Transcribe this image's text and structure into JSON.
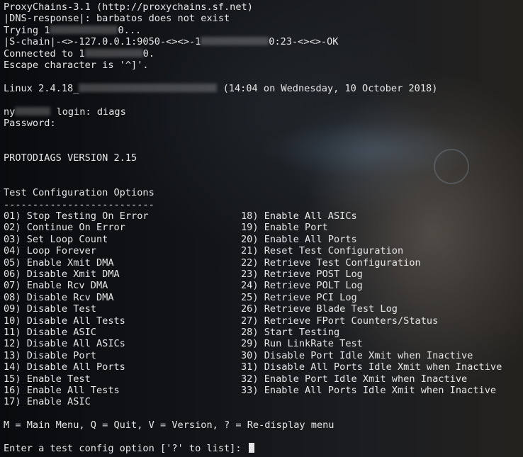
{
  "header": {
    "proxy_banner": "ProxyChains-3.1 (http://proxychains.sf.net)",
    "dns_response": "|DNS-response|: barbatos does not exist",
    "trying_prefix": "Trying 1",
    "trying_suffix": "0...",
    "schain_prefix": "|S-chain|-<>-127.0.0.1:9050-<><>-1",
    "schain_suffix": "0:23-<><>-OK",
    "connected_prefix": "Connected to 1",
    "connected_suffix": "0.",
    "escape": "Escape character is '^]'."
  },
  "login": {
    "linux_prefix": "Linux 2.4.18_",
    "linux_suffix": "(14:04 on Wednesday, 10 October 2018)",
    "host_prefix": "ny",
    "login_suffix": " login: diags",
    "password": "Password:"
  },
  "banner": {
    "version": "PROTODIAGS VERSION 2.15"
  },
  "menu": {
    "title": "Test Configuration Options",
    "underline": "--------------------------",
    "left": [
      "01) Stop Testing On Error",
      "02) Continue On Error",
      "03) Set Loop Count",
      "04) Loop Forever",
      "05) Enable Xmit DMA",
      "06) Disable Xmit DMA",
      "07) Enable Rcv DMA",
      "08) Disable Rcv DMA",
      "09) Disable Test",
      "10) Disable All Tests",
      "11) Disable ASIC",
      "12) Disable All ASICs",
      "13) Disable Port",
      "14) Disable All Ports",
      "15) Enable Test",
      "16) Enable All Tests",
      "17) Enable ASIC"
    ],
    "right": [
      "18) Enable All ASICs",
      "19) Enable Port",
      "20) Enable All Ports",
      "21) Reset Test Configuration",
      "22) Retrieve Test Configuration",
      "23) Retrieve POST Log",
      "24) Retrieve POLT Log",
      "25) Retrieve PCI Log",
      "26) Retrieve Blade Test Log",
      "27) Retrieve FPort Counters/Status",
      "28) Start Testing",
      "29) Run LinkRate Test",
      "30) Disable Port Idle Xmit when Inactive",
      "31) Disable All Ports Idle Xmit when Inactive",
      "32) Enable Port Idle Xmit when Inactive",
      "33) Enable All Ports Idle Xmit when Inactive"
    ]
  },
  "footer": {
    "help": "M = Main Menu, Q = Quit, V = Version, ? = Re-display menu",
    "prompt": "Enter a test config option ['?' to list]: "
  }
}
